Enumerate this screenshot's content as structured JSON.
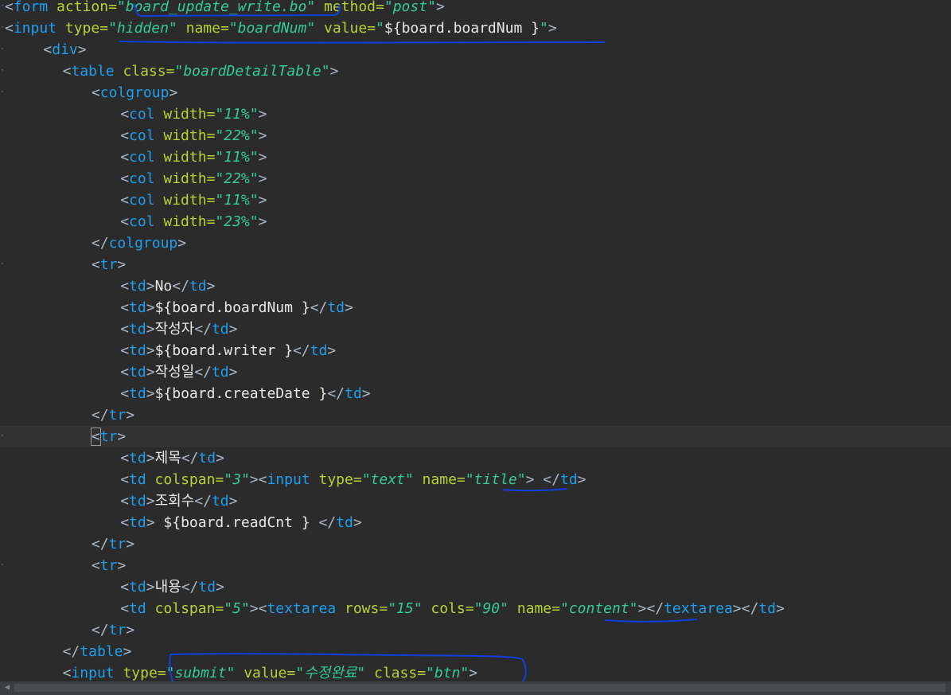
{
  "editor": {
    "lines": [
      {
        "indent": 0,
        "tokens": [
          [
            "p",
            "<"
          ],
          [
            "g",
            "form"
          ],
          [
            "a",
            " action"
          ],
          [
            "e",
            "="
          ],
          [
            "s",
            "\"board_update_write.bo\""
          ],
          [
            "a",
            " method"
          ],
          [
            "e",
            "="
          ],
          [
            "s",
            "\"post\""
          ],
          [
            "p",
            ">"
          ]
        ]
      },
      {
        "indent": 0,
        "tokens": [
          [
            "p",
            "<"
          ],
          [
            "g",
            "input"
          ],
          [
            "a",
            " type"
          ],
          [
            "e",
            "="
          ],
          [
            "s",
            "\"hidden\""
          ],
          [
            "a",
            " name"
          ],
          [
            "e",
            "="
          ],
          [
            "s",
            "\"boardNum\""
          ],
          [
            "a",
            " value"
          ],
          [
            "e",
            "="
          ],
          [
            "s",
            "\""
          ],
          [
            "t",
            "${board.boardNum }"
          ],
          [
            "s",
            "\""
          ],
          [
            "p",
            ">"
          ]
        ]
      },
      {
        "indent": 4,
        "tokens": [
          [
            "p",
            "<"
          ],
          [
            "g",
            "div"
          ],
          [
            "p",
            ">"
          ]
        ]
      },
      {
        "indent": 6,
        "tokens": [
          [
            "p",
            "<"
          ],
          [
            "g",
            "table"
          ],
          [
            "a",
            " class"
          ],
          [
            "e",
            "="
          ],
          [
            "s",
            "\"boardDetailTable\""
          ],
          [
            "p",
            ">"
          ]
        ]
      },
      {
        "indent": 9,
        "tokens": [
          [
            "p",
            "<"
          ],
          [
            "g",
            "colgroup"
          ],
          [
            "p",
            ">"
          ]
        ]
      },
      {
        "indent": 12,
        "tokens": [
          [
            "p",
            "<"
          ],
          [
            "g",
            "col"
          ],
          [
            "a",
            " width"
          ],
          [
            "e",
            "="
          ],
          [
            "s",
            "\"11%\""
          ],
          [
            "p",
            ">"
          ]
        ]
      },
      {
        "indent": 12,
        "tokens": [
          [
            "p",
            "<"
          ],
          [
            "g",
            "col"
          ],
          [
            "a",
            " width"
          ],
          [
            "e",
            "="
          ],
          [
            "s",
            "\"22%\""
          ],
          [
            "p",
            ">"
          ]
        ]
      },
      {
        "indent": 12,
        "tokens": [
          [
            "p",
            "<"
          ],
          [
            "g",
            "col"
          ],
          [
            "a",
            " width"
          ],
          [
            "e",
            "="
          ],
          [
            "s",
            "\"11%\""
          ],
          [
            "p",
            ">"
          ]
        ]
      },
      {
        "indent": 12,
        "tokens": [
          [
            "p",
            "<"
          ],
          [
            "g",
            "col"
          ],
          [
            "a",
            " width"
          ],
          [
            "e",
            "="
          ],
          [
            "s",
            "\"22%\""
          ],
          [
            "p",
            ">"
          ]
        ]
      },
      {
        "indent": 12,
        "tokens": [
          [
            "p",
            "<"
          ],
          [
            "g",
            "col"
          ],
          [
            "a",
            " width"
          ],
          [
            "e",
            "="
          ],
          [
            "s",
            "\"11%\""
          ],
          [
            "p",
            ">"
          ]
        ]
      },
      {
        "indent": 12,
        "tokens": [
          [
            "p",
            "<"
          ],
          [
            "g",
            "col"
          ],
          [
            "a",
            " width"
          ],
          [
            "e",
            "="
          ],
          [
            "s",
            "\"23%\""
          ],
          [
            "p",
            ">"
          ]
        ]
      },
      {
        "indent": 9,
        "tokens": [
          [
            "p",
            "</"
          ],
          [
            "g",
            "colgroup"
          ],
          [
            "p",
            ">"
          ]
        ]
      },
      {
        "indent": 9,
        "tokens": [
          [
            "p",
            "<"
          ],
          [
            "g",
            "tr"
          ],
          [
            "p",
            ">"
          ]
        ]
      },
      {
        "indent": 12,
        "tokens": [
          [
            "p",
            "<"
          ],
          [
            "g",
            "td"
          ],
          [
            "p",
            ">"
          ],
          [
            "t",
            "No"
          ],
          [
            "p",
            "</"
          ],
          [
            "g",
            "td"
          ],
          [
            "p",
            ">"
          ]
        ]
      },
      {
        "indent": 12,
        "tokens": [
          [
            "p",
            "<"
          ],
          [
            "g",
            "td"
          ],
          [
            "p",
            ">"
          ],
          [
            "t",
            "${board.boardNum }"
          ],
          [
            "p",
            "</"
          ],
          [
            "g",
            "td"
          ],
          [
            "p",
            ">"
          ]
        ]
      },
      {
        "indent": 12,
        "tokens": [
          [
            "p",
            "<"
          ],
          [
            "g",
            "td"
          ],
          [
            "p",
            ">"
          ],
          [
            "t",
            "작성자"
          ],
          [
            "p",
            "</"
          ],
          [
            "g",
            "td"
          ],
          [
            "p",
            ">"
          ]
        ]
      },
      {
        "indent": 12,
        "tokens": [
          [
            "p",
            "<"
          ],
          [
            "g",
            "td"
          ],
          [
            "p",
            ">"
          ],
          [
            "t",
            "${board.writer }"
          ],
          [
            "p",
            "</"
          ],
          [
            "g",
            "td"
          ],
          [
            "p",
            ">"
          ]
        ]
      },
      {
        "indent": 12,
        "tokens": [
          [
            "p",
            "<"
          ],
          [
            "g",
            "td"
          ],
          [
            "p",
            ">"
          ],
          [
            "t",
            "작성일"
          ],
          [
            "p",
            "</"
          ],
          [
            "g",
            "td"
          ],
          [
            "p",
            ">"
          ]
        ]
      },
      {
        "indent": 12,
        "tokens": [
          [
            "p",
            "<"
          ],
          [
            "g",
            "td"
          ],
          [
            "p",
            ">"
          ],
          [
            "t",
            "${board.createDate }"
          ],
          [
            "p",
            "</"
          ],
          [
            "g",
            "td"
          ],
          [
            "p",
            ">"
          ]
        ]
      },
      {
        "indent": 9,
        "tokens": [
          [
            "p",
            "</"
          ],
          [
            "g",
            "tr"
          ],
          [
            "p",
            ">"
          ]
        ]
      },
      {
        "indent": 9,
        "current": true,
        "tokens": [
          [
            "c",
            "<"
          ],
          [
            "g",
            "tr"
          ],
          [
            "p",
            ">"
          ]
        ]
      },
      {
        "indent": 12,
        "tokens": [
          [
            "p",
            "<"
          ],
          [
            "g",
            "td"
          ],
          [
            "p",
            ">"
          ],
          [
            "t",
            "제목"
          ],
          [
            "p",
            "</"
          ],
          [
            "g",
            "td"
          ],
          [
            "p",
            ">"
          ]
        ]
      },
      {
        "indent": 12,
        "tokens": [
          [
            "p",
            "<"
          ],
          [
            "g",
            "td"
          ],
          [
            "a",
            " colspan"
          ],
          [
            "e",
            "="
          ],
          [
            "s",
            "\"3\""
          ],
          [
            "p",
            ">"
          ],
          [
            "p",
            "<"
          ],
          [
            "g",
            "input"
          ],
          [
            "a",
            " type"
          ],
          [
            "e",
            "="
          ],
          [
            "s",
            "\"text\""
          ],
          [
            "a",
            " name"
          ],
          [
            "e",
            "="
          ],
          [
            "s",
            "\"title\""
          ],
          [
            "p",
            ">"
          ],
          [
            "t",
            " "
          ],
          [
            "p",
            "</"
          ],
          [
            "g",
            "td"
          ],
          [
            "p",
            ">"
          ]
        ]
      },
      {
        "indent": 12,
        "tokens": [
          [
            "p",
            "<"
          ],
          [
            "g",
            "td"
          ],
          [
            "p",
            ">"
          ],
          [
            "t",
            "조회수"
          ],
          [
            "p",
            "</"
          ],
          [
            "g",
            "td"
          ],
          [
            "p",
            ">"
          ]
        ]
      },
      {
        "indent": 12,
        "tokens": [
          [
            "p",
            "<"
          ],
          [
            "g",
            "td"
          ],
          [
            "p",
            ">"
          ],
          [
            "t",
            " ${board.readCnt } "
          ],
          [
            "p",
            "</"
          ],
          [
            "g",
            "td"
          ],
          [
            "p",
            ">"
          ]
        ]
      },
      {
        "indent": 9,
        "tokens": [
          [
            "p",
            "</"
          ],
          [
            "g",
            "tr"
          ],
          [
            "p",
            ">"
          ]
        ]
      },
      {
        "indent": 9,
        "tokens": [
          [
            "p",
            "<"
          ],
          [
            "g",
            "tr"
          ],
          [
            "p",
            ">"
          ]
        ]
      },
      {
        "indent": 12,
        "tokens": [
          [
            "p",
            "<"
          ],
          [
            "g",
            "td"
          ],
          [
            "p",
            ">"
          ],
          [
            "t",
            "내용"
          ],
          [
            "p",
            "</"
          ],
          [
            "g",
            "td"
          ],
          [
            "p",
            ">"
          ]
        ]
      },
      {
        "indent": 12,
        "tokens": [
          [
            "p",
            "<"
          ],
          [
            "g",
            "td"
          ],
          [
            "a",
            " colspan"
          ],
          [
            "e",
            "="
          ],
          [
            "s",
            "\"5\""
          ],
          [
            "p",
            ">"
          ],
          [
            "p",
            "<"
          ],
          [
            "g",
            "textarea"
          ],
          [
            "a",
            " rows"
          ],
          [
            "e",
            "="
          ],
          [
            "s",
            "\"15\""
          ],
          [
            "a",
            " cols"
          ],
          [
            "e",
            "="
          ],
          [
            "s",
            "\"90\""
          ],
          [
            "a",
            " name"
          ],
          [
            "e",
            "="
          ],
          [
            "s",
            "\"content\""
          ],
          [
            "p",
            ">"
          ],
          [
            "p",
            "</"
          ],
          [
            "g",
            "textarea"
          ],
          [
            "p",
            ">"
          ],
          [
            "p",
            "</"
          ],
          [
            "g",
            "td"
          ],
          [
            "p",
            ">"
          ]
        ]
      },
      {
        "indent": 9,
        "tokens": [
          [
            "p",
            "</"
          ],
          [
            "g",
            "tr"
          ],
          [
            "p",
            ">"
          ]
        ]
      },
      {
        "indent": 6,
        "tokens": [
          [
            "p",
            "</"
          ],
          [
            "g",
            "table"
          ],
          [
            "p",
            ">"
          ]
        ]
      },
      {
        "indent": 6,
        "tokens": [
          [
            "p",
            "<"
          ],
          [
            "g",
            "input"
          ],
          [
            "a",
            " type"
          ],
          [
            "e",
            "="
          ],
          [
            "s",
            "\"submit\""
          ],
          [
            "a",
            " value"
          ],
          [
            "e",
            "="
          ],
          [
            "s",
            "\"수정완료\""
          ],
          [
            "a",
            " class"
          ],
          [
            "e",
            "="
          ],
          [
            "s",
            "\"btn\""
          ],
          [
            "p",
            ">"
          ]
        ]
      }
    ],
    "fold_markers": [
      0,
      1,
      2,
      3,
      4,
      12,
      20,
      26
    ],
    "colors": {
      "background": "#2b2b2b",
      "tag": "#1e9ff0",
      "attribute": "#b5d334",
      "string": "#33cc99",
      "text": "#e8e8e8",
      "annotation_ink": "#1040e0"
    }
  },
  "scrollbar": {
    "left_arrow_icon": "triangle-left-icon"
  }
}
